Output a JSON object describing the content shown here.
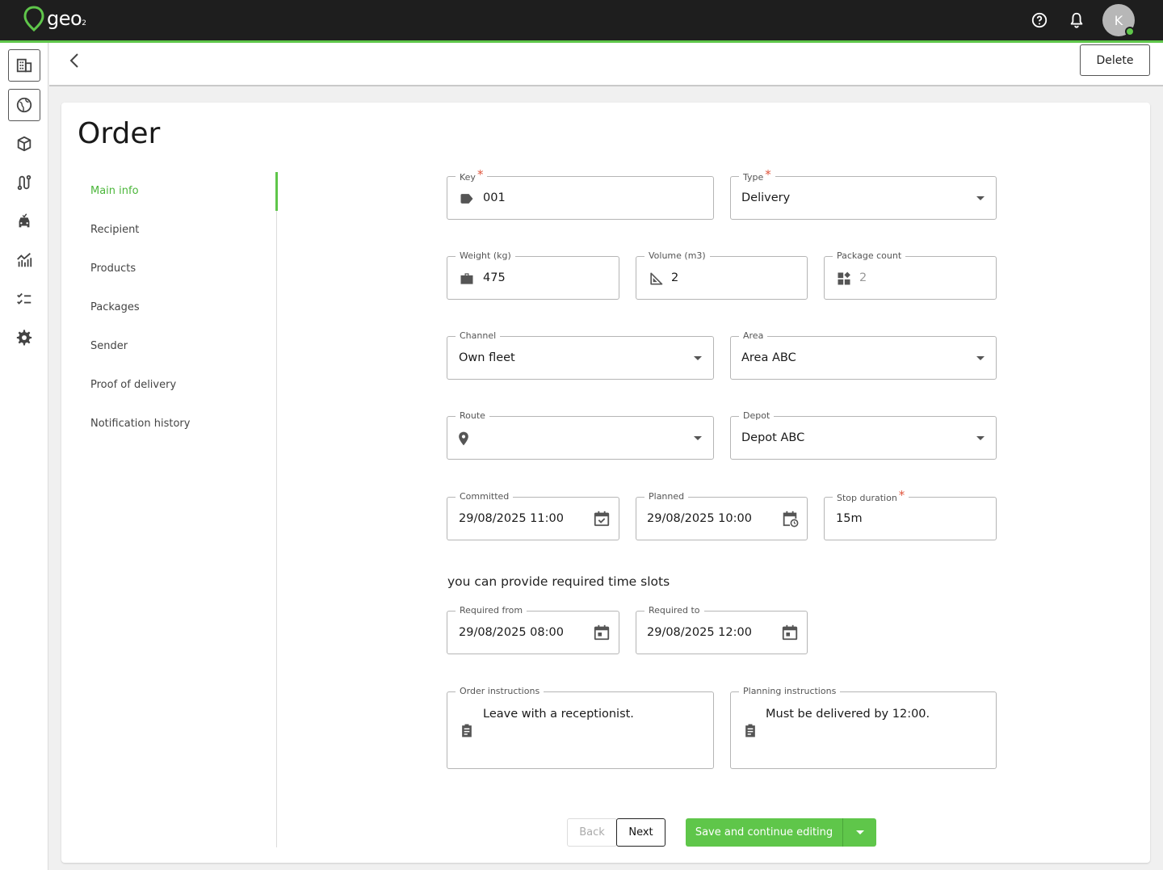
{
  "app": {
    "logo_text": "geo",
    "logo_sub": "2",
    "avatar_initial": "K"
  },
  "header": {
    "delete_label": "Delete"
  },
  "page": {
    "title": "Order"
  },
  "sidenav": {
    "items": [
      {
        "label": "Main info",
        "active": true
      },
      {
        "label": "Recipient"
      },
      {
        "label": "Products"
      },
      {
        "label": "Packages"
      },
      {
        "label": "Sender"
      },
      {
        "label": "Proof of delivery"
      },
      {
        "label": "Notification history"
      }
    ]
  },
  "form": {
    "key": {
      "label": "Key",
      "value": "001"
    },
    "type": {
      "label": "Type",
      "value": "Delivery"
    },
    "weight": {
      "label": "Weight (kg)",
      "value": "475"
    },
    "volume": {
      "label": "Volume (m3)",
      "value": "2"
    },
    "package_count": {
      "label": "Package count",
      "value": "2"
    },
    "channel": {
      "label": "Channel",
      "value": "Own fleet"
    },
    "area": {
      "label": "Area",
      "value": "Area ABC"
    },
    "route": {
      "label": "Route",
      "value": ""
    },
    "depot": {
      "label": "Depot",
      "value": "Depot ABC"
    },
    "committed": {
      "label": "Committed",
      "value": "29/08/2025 11:00"
    },
    "planned": {
      "label": "Planned",
      "value": "29/08/2025 10:00"
    },
    "stop_duration": {
      "label": "Stop duration",
      "value": "15m"
    },
    "time_slots_hint": "you can provide required time slots",
    "required_from": {
      "label": "Required from",
      "value": "29/08/2025 08:00"
    },
    "required_to": {
      "label": "Required to",
      "value": "29/08/2025 12:00"
    },
    "order_instructions": {
      "label": "Order instructions",
      "value": "Leave with a receptionist."
    },
    "planning_instructions": {
      "label": "Planning instructions",
      "value": "Must be delivered by 12:00."
    }
  },
  "actions": {
    "back_label": "Back",
    "next_label": "Next",
    "save_label": "Save and continue editing"
  },
  "colors": {
    "accent": "#5fc64a",
    "topbar": "#1e1e1e",
    "required": "#e0553d"
  }
}
